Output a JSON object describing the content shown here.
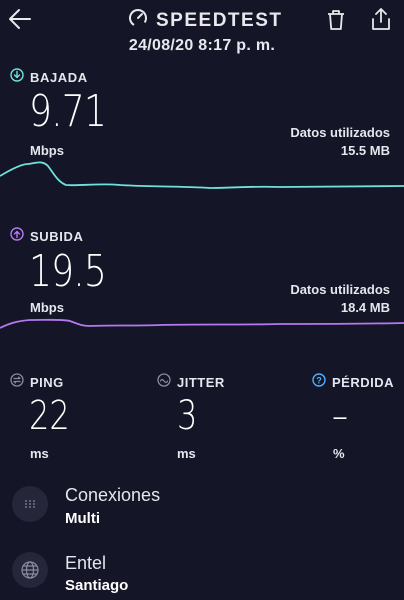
{
  "header": {
    "title": "SPEEDTEST",
    "datetime": "24/08/20 8:17 p. m."
  },
  "download": {
    "title": "BAJADA",
    "value": "9.71",
    "unit": "Mbps",
    "data_label": "Datos utilizados",
    "data_value": "15.5 MB",
    "color": "#6fe2dc"
  },
  "upload": {
    "title": "SUBIDA",
    "value": "19.5",
    "unit": "Mbps",
    "data_label": "Datos utilizados",
    "data_value": "18.4 MB",
    "color": "#b678f0"
  },
  "stats": {
    "ping": {
      "title": "PING",
      "value": "22",
      "unit": "ms"
    },
    "jitter": {
      "title": "JITTER",
      "value": "3",
      "unit": "ms"
    },
    "loss": {
      "title": "PÉRDIDA",
      "value": "–",
      "unit": "%",
      "color": "#4fb0ff"
    }
  },
  "connections": {
    "title": "Conexiones",
    "value": "Multi"
  },
  "server": {
    "title": "Entel",
    "value": "Santiago"
  }
}
